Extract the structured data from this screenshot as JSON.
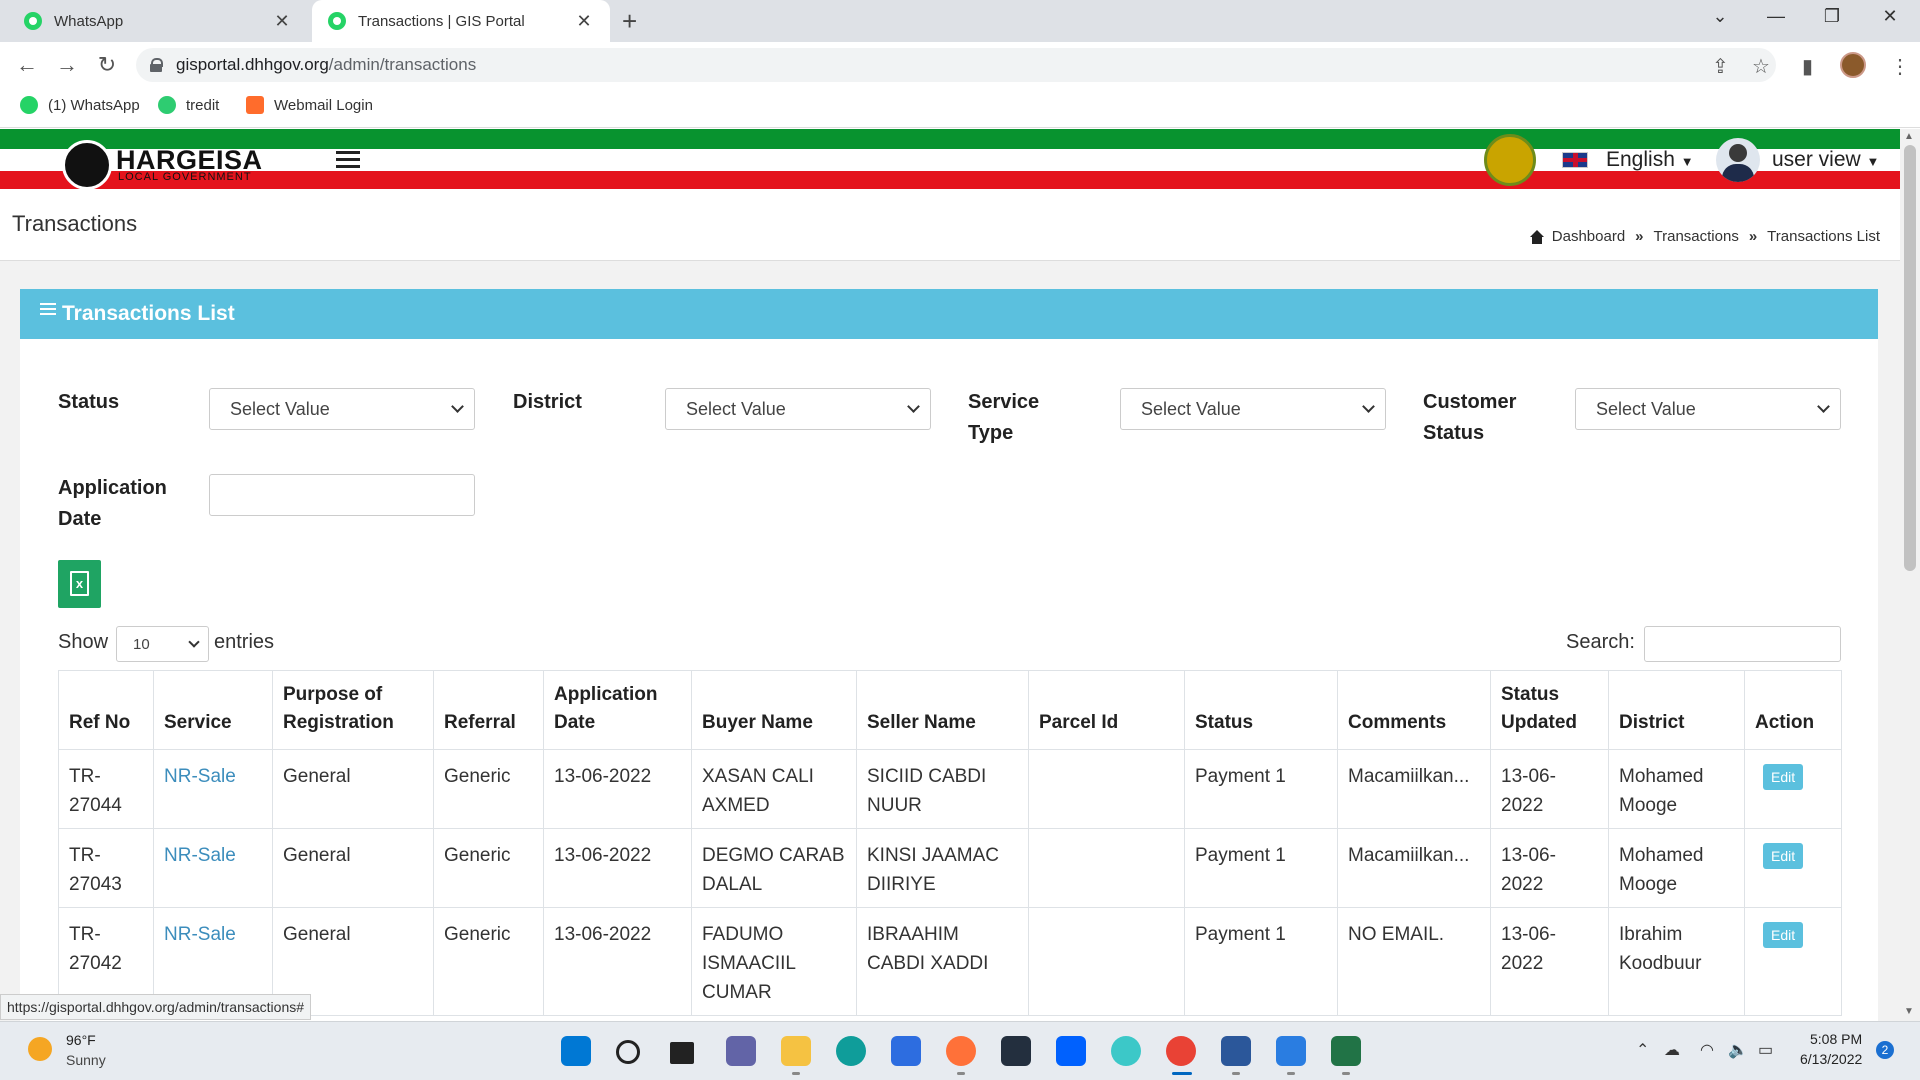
{
  "browser": {
    "tabs": [
      {
        "title": "WhatsApp",
        "active": false
      },
      {
        "title": "Transactions | GIS Portal",
        "active": true
      }
    ],
    "url_host": "gisportal.dhhgov.org",
    "url_path": "/admin/transactions",
    "bookmarks": [
      {
        "label": "(1) WhatsApp",
        "color": "#25d366"
      },
      {
        "label": "tredit",
        "color": "#2ecc71"
      },
      {
        "label": "Webmail Login",
        "color": "#ff6c2c"
      }
    ],
    "status_url": "https://gisportal.dhhgov.org/admin/transactions#"
  },
  "header": {
    "logo_title": "HARGEISA",
    "logo_subtitle": "LOCAL GOVERNMENT",
    "language": "English",
    "user": "user view",
    "colors": {
      "green": "#08932f",
      "red": "#e4131c",
      "accent": "#5bc0de"
    }
  },
  "page": {
    "title": "Transactions",
    "breadcrumb": [
      "Dashboard",
      "Transactions",
      "Transactions List"
    ]
  },
  "card": {
    "title": "Transactions List",
    "filters": {
      "status_label": "Status",
      "district_label": "District",
      "service_type_label_1": "Service",
      "service_type_label_2": "Type",
      "customer_status_label_1": "Customer",
      "customer_status_label_2": "Status",
      "application_date_label_1": "Application",
      "application_date_label_2": "Date",
      "select_placeholder": "Select Value"
    },
    "show_label": "Show",
    "entries_label": "entries",
    "page_length": "10",
    "search_label": "Search:"
  },
  "table": {
    "columns": {
      "ref_no": "Ref No",
      "service": "Service",
      "purpose_1": "Purpose of",
      "purpose_2": "Registration",
      "referral": "Referral",
      "app_date_1": "Application",
      "app_date_2": "Date",
      "buyer": "Buyer Name",
      "seller": "Seller Name",
      "parcel": "Parcel Id",
      "status": "Status",
      "comments": "Comments",
      "status_updated_1": "Status",
      "status_updated_2": "Updated",
      "district": "District",
      "action": "Action"
    },
    "rows": [
      {
        "ref_1": "TR-",
        "ref_2": "27044",
        "service": "NR-Sale",
        "purpose": "General",
        "referral": "Generic",
        "app_date": "13-06-2022",
        "buyer_1": "XASAN CALI",
        "buyer_2": "AXMED",
        "buyer_3": "",
        "seller_1": "SICIID CABDI",
        "seller_2": "NUUR",
        "parcel": "",
        "status": "Payment 1",
        "comments": "Macamiilkan...",
        "updated_1": "13-06-",
        "updated_2": "2022",
        "district_1": "Mohamed",
        "district_2": "Mooge",
        "action": "Edit"
      },
      {
        "ref_1": "TR-",
        "ref_2": "27043",
        "service": "NR-Sale",
        "purpose": "General",
        "referral": "Generic",
        "app_date": "13-06-2022",
        "buyer_1": "DEGMO CARAB",
        "buyer_2": "DALAL",
        "buyer_3": "",
        "seller_1": "KINSI JAAMAC",
        "seller_2": "DIIRIYE",
        "parcel": "",
        "status": "Payment 1",
        "comments": "Macamiilkan...",
        "updated_1": "13-06-",
        "updated_2": "2022",
        "district_1": "Mohamed",
        "district_2": "Mooge",
        "action": "Edit"
      },
      {
        "ref_1": "TR-",
        "ref_2": "27042",
        "service": "NR-Sale",
        "purpose": "General",
        "referral": "Generic",
        "app_date": "13-06-2022",
        "buyer_1": "FADUMO",
        "buyer_2": "ISMAACIIL",
        "buyer_3": "CUMAR",
        "seller_1": "IBRAAHIM",
        "seller_2": "CABDI XADDI",
        "parcel": "",
        "status": "Payment 1",
        "comments": "NO EMAIL.",
        "updated_1": "13-06-",
        "updated_2": "2022",
        "district_1": "Ibrahim",
        "district_2": "Koodbuur",
        "action": "Edit"
      }
    ]
  },
  "taskbar": {
    "weather_temp": "96°F",
    "weather_desc": "Sunny",
    "time": "5:08 PM",
    "date": "6/13/2022",
    "notifications": "2"
  }
}
